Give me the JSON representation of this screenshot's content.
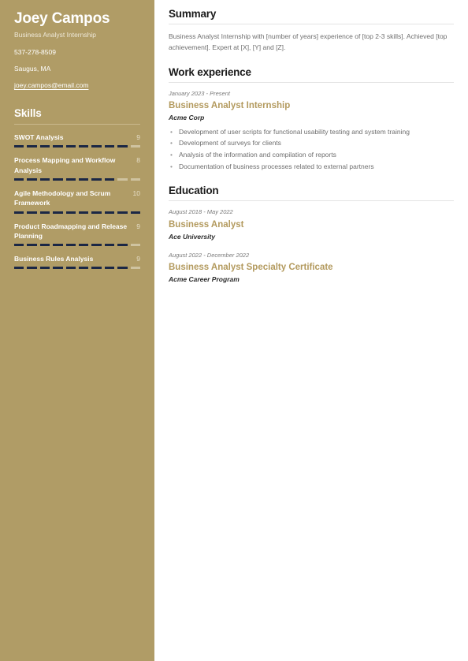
{
  "theme": {
    "sidebar_bg": "#b09c66",
    "accent_gold": "#b39a5e",
    "skill_filled": "#1b2745",
    "skill_empty": "#cfc3a0",
    "page_bg": "#ffffff"
  },
  "sidebar": {
    "name": "Joey Campos",
    "subtitle": "Business Analyst Internship",
    "phone": "537-278-8509",
    "location": "Saugus, MA",
    "email": "joey.campos@email.com",
    "skills_heading": "Skills",
    "skill_max": 10,
    "skills": [
      {
        "label": "SWOT Analysis",
        "score": 9
      },
      {
        "label": "Process Mapping and Workflow Analysis",
        "score": 8
      },
      {
        "label": "Agile Methodology and Scrum Framework",
        "score": 10
      },
      {
        "label": "Product Roadmapping and Release Planning",
        "score": 9
      },
      {
        "label": "Business Rules Analysis",
        "score": 9
      }
    ]
  },
  "main": {
    "summary": {
      "heading": "Summary",
      "text": "Business Analyst Internship with [number of years] experience of [top 2-3 skills]. Achieved [top achievement]. Expert at [X], [Y] and [Z]."
    },
    "work_experience": {
      "heading": "Work experience",
      "entries": [
        {
          "date": "January 2023 - Present",
          "title": "Business Analyst Internship",
          "org": "Acme Corp",
          "bullets": [
            "Development of user scripts for functional usability testing and system training",
            "Development of surveys for clients",
            "Analysis of the information and compilation of reports",
            "Documentation of business processes related to external partners"
          ]
        }
      ]
    },
    "education": {
      "heading": "Education",
      "entries": [
        {
          "date": "August 2018 - May 2022",
          "title": "Business Analyst",
          "org": "Ace University",
          "bullets": []
        },
        {
          "date": "August 2022 - December 2022",
          "title": "Business Analyst Specialty Certificate",
          "org": "Acme Career Program",
          "bullets": []
        }
      ]
    }
  }
}
